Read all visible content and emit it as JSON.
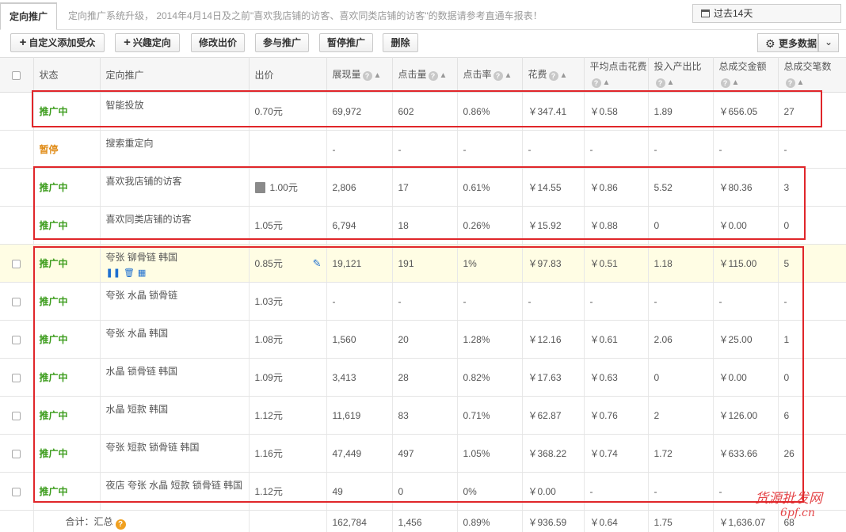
{
  "tab": {
    "label": "定向推广"
  },
  "notice": "定向推广系统升级， 2014年4月14日及之前\"喜欢我店铺的访客、喜欢同类店铺的访客\"的数据请参考直通车报表！",
  "period": {
    "label": "过去14天"
  },
  "toolbar": {
    "add_custom": "自定义添加受众",
    "interest": "兴趣定向",
    "edit_bid": "修改出价",
    "join": "参与推广",
    "pause": "暂停推广",
    "delete": "删除",
    "more": "更多数据"
  },
  "headers": {
    "status": "状态",
    "target": "定向推广",
    "bid": "出价",
    "impressions": "展现量",
    "clicks": "点击量",
    "ctr": "点击率",
    "cost": "花费",
    "cpc": "平均点击花费",
    "roi": "投入产出比",
    "gmv": "总成交金额",
    "orders": "总成交笔数"
  },
  "rows": [
    {
      "status": "推广中",
      "name": "智能投放",
      "bid": "0.70元",
      "impressions": "69,972",
      "clicks": "602",
      "ctr": "0.86%",
      "cost": "￥347.41",
      "cpc": "￥0.58",
      "roi": "1.89",
      "gmv": "￥656.05",
      "orders": "27"
    },
    {
      "status": "暂停",
      "name": "搜索重定向",
      "bid": "",
      "impressions": "-",
      "clicks": "-",
      "ctr": "-",
      "cost": "-",
      "cpc": "-",
      "roi": "-",
      "gmv": "-",
      "orders": "-"
    },
    {
      "status": "推广中",
      "name": "喜欢我店铺的访客",
      "bid": "1.00元",
      "impressions": "2,806",
      "clicks": "17",
      "ctr": "0.61%",
      "cost": "￥14.55",
      "cpc": "￥0.86",
      "roi": "5.52",
      "gmv": "￥80.36",
      "orders": "3"
    },
    {
      "status": "推广中",
      "name": "喜欢同类店铺的访客",
      "bid": "1.05元",
      "impressions": "6,794",
      "clicks": "18",
      "ctr": "0.26%",
      "cost": "￥15.92",
      "cpc": "￥0.88",
      "roi": "0",
      "gmv": "￥0.00",
      "orders": "0"
    },
    {
      "status": "推广中",
      "name": "夸张 铆骨链 韩国",
      "bid": "0.85元",
      "impressions": "19,121",
      "clicks": "191",
      "ctr": "1%",
      "cost": "￥97.83",
      "cpc": "￥0.51",
      "roi": "1.18",
      "gmv": "￥115.00",
      "orders": "5"
    },
    {
      "status": "推广中",
      "name": "夸张 水晶 锁骨链",
      "bid": "1.03元",
      "impressions": "-",
      "clicks": "-",
      "ctr": "-",
      "cost": "-",
      "cpc": "-",
      "roi": "-",
      "gmv": "-",
      "orders": "-"
    },
    {
      "status": "推广中",
      "name": "夸张 水晶 韩国",
      "bid": "1.08元",
      "impressions": "1,560",
      "clicks": "20",
      "ctr": "1.28%",
      "cost": "￥12.16",
      "cpc": "￥0.61",
      "roi": "2.06",
      "gmv": "￥25.00",
      "orders": "1"
    },
    {
      "status": "推广中",
      "name": "水晶 锁骨链 韩国",
      "bid": "1.09元",
      "impressions": "3,413",
      "clicks": "28",
      "ctr": "0.82%",
      "cost": "￥17.63",
      "cpc": "￥0.63",
      "roi": "0",
      "gmv": "￥0.00",
      "orders": "0"
    },
    {
      "status": "推广中",
      "name": "水晶 短款 韩国",
      "bid": "1.12元",
      "impressions": "11,619",
      "clicks": "83",
      "ctr": "0.71%",
      "cost": "￥62.87",
      "cpc": "￥0.76",
      "roi": "2",
      "gmv": "￥126.00",
      "orders": "6"
    },
    {
      "status": "推广中",
      "name": "夸张 短款 锁骨链 韩国",
      "bid": "1.16元",
      "impressions": "47,449",
      "clicks": "497",
      "ctr": "1.05%",
      "cost": "￥368.22",
      "cpc": "￥0.74",
      "roi": "1.72",
      "gmv": "￥633.66",
      "orders": "26"
    },
    {
      "status": "推广中",
      "name": "夜店 夸张 水晶 短款 锁骨链 韩国",
      "bid": "1.12元",
      "impressions": "49",
      "clicks": "0",
      "ctr": "0%",
      "cost": "￥0.00",
      "cpc": "-",
      "roi": "-",
      "gmv": "-",
      "orders": "-"
    }
  ],
  "summary": {
    "label": "合计：汇总",
    "impressions": "162,784",
    "clicks": "1,456",
    "ctr": "0.89%",
    "cost": "￥936.59",
    "cpc": "￥0.64",
    "roi": "1.75",
    "gmv": "￥1,636.07",
    "orders": "68"
  },
  "watermark": {
    "line1": "货源批发网",
    "line2": "6pf.cn"
  },
  "colors": {
    "active": "#3a9b1a",
    "paused": "#e08c18",
    "highlight_border": "#e0262a",
    "selected_row": "#fffde4"
  }
}
